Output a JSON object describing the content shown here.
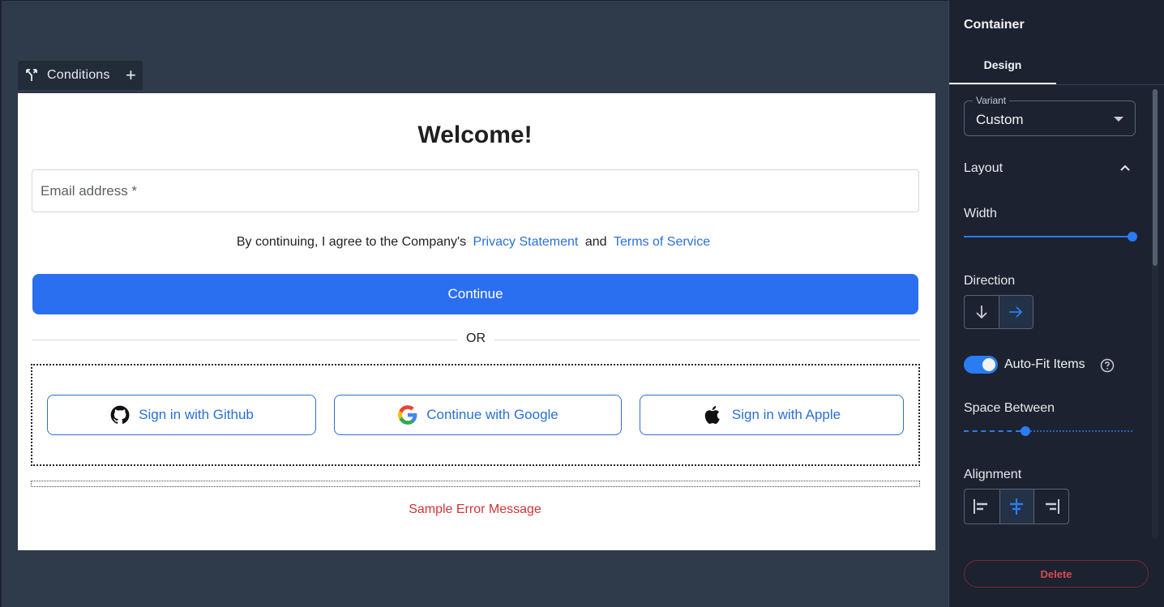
{
  "canvas": {
    "conditions_label": "Conditions",
    "conditions_add": "+"
  },
  "form": {
    "title": "Welcome!",
    "email_placeholder": "Email address *",
    "agree_prefix": "By continuing, I agree to the Company's",
    "privacy_link": "Privacy Statement",
    "agree_and": "and",
    "terms_link": "Terms of Service",
    "continue_label": "Continue",
    "divider_label": "OR",
    "social": [
      {
        "label": "Sign in with Github",
        "icon": "github-icon"
      },
      {
        "label": "Continue with Google",
        "icon": "google-icon"
      },
      {
        "label": "Sign in with Apple",
        "icon": "apple-icon"
      }
    ],
    "error_message": "Sample Error Message"
  },
  "panel": {
    "title": "Container",
    "tab": "Design",
    "variant_label": "Variant",
    "variant_value": "Custom",
    "layout_label": "Layout",
    "width_label": "Width",
    "width_value": 1.0,
    "direction_label": "Direction",
    "direction_selected": "horizontal",
    "autofit_label": "Auto-Fit Items",
    "autofit_on": true,
    "space_between_label": "Space Between",
    "space_between_value": 0.36,
    "alignment_label": "Alignment",
    "alignment_selected": "center",
    "delete_label": "Delete"
  },
  "colors": {
    "accent": "#2a6ff0",
    "link": "#2a6fd6",
    "error": "#d23434",
    "panel_bg": "#1c2230",
    "canvas_bg": "#2f3a4a"
  }
}
